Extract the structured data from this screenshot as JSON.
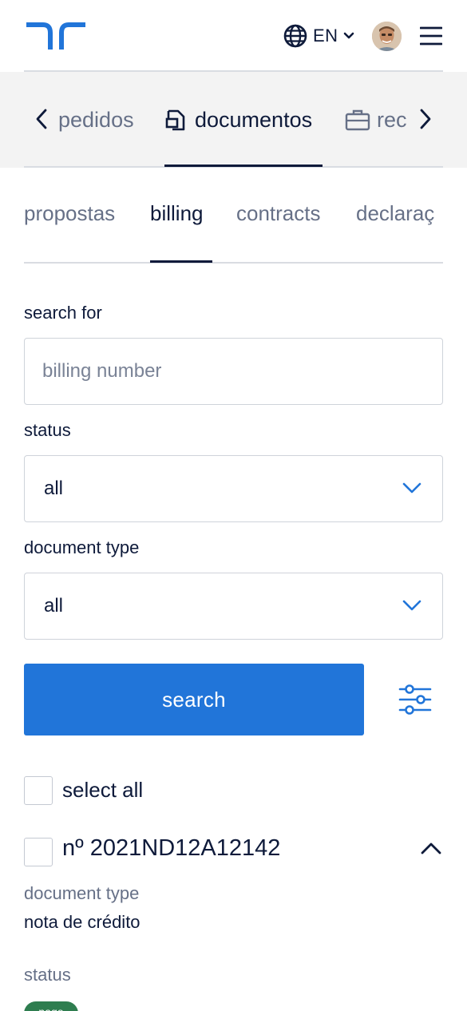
{
  "header": {
    "language": "EN",
    "logo_icon": "brand-logo",
    "avatar_icon": "user-avatar",
    "menu_icon": "hamburger-menu-icon"
  },
  "section_nav": {
    "items": [
      {
        "label": "pedidos",
        "icon": "none",
        "active": false
      },
      {
        "label": "documentos",
        "icon": "document-icon",
        "active": true
      },
      {
        "label": "rec",
        "icon": "briefcase-icon",
        "active": false
      }
    ]
  },
  "sub_tabs": [
    {
      "label": "propostas",
      "active": false
    },
    {
      "label": "billing",
      "active": true
    },
    {
      "label": "contracts",
      "active": false
    },
    {
      "label": "declaraç",
      "active": false
    }
  ],
  "form": {
    "search_label": "search for",
    "search_placeholder": "billing number",
    "status_label": "status",
    "status_value": "all",
    "doc_type_label": "document type",
    "doc_type_value": "all",
    "search_button": "search"
  },
  "list": {
    "select_all_label": "select all",
    "items": [
      {
        "number": "nº 2021ND12A12142",
        "doc_type_label": "document type",
        "doc_type_value": "nota de crédito",
        "status_label": "status",
        "status_value": "pago",
        "expanded": true
      }
    ]
  },
  "colors": {
    "primary": "#2175d9",
    "text": "#0e1a3a",
    "muted": "#667087",
    "band": "#f3f3f3",
    "status_green": "#2e7d4f"
  }
}
